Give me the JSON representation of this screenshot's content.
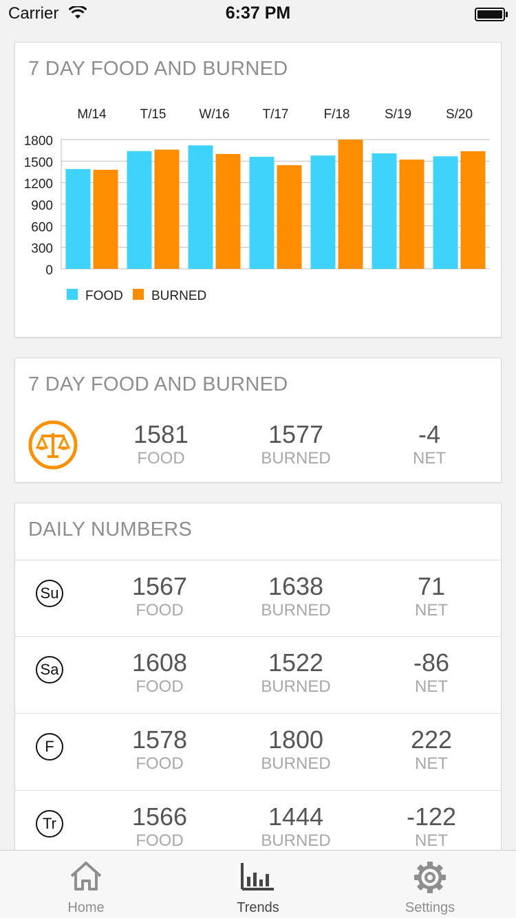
{
  "status_bar": {
    "carrier": "Carrier",
    "time": "6:37 PM",
    "wifi_icon": "wifi-icon",
    "battery_icon": "battery-icon"
  },
  "colors": {
    "food": "#3fd3fb",
    "burned": "#fd8e02",
    "accent": "#fd9100"
  },
  "chart_card": {
    "title": "7 DAY FOOD AND BURNED",
    "chart_data": {
      "type": "bar",
      "categories": [
        "M/14",
        "T/15",
        "W/16",
        "T/17",
        "F/18",
        "S/19",
        "S/20"
      ],
      "series": [
        {
          "name": "FOOD",
          "values": [
            1390,
            1640,
            1720,
            1560,
            1578,
            1608,
            1567
          ]
        },
        {
          "name": "BURNED",
          "values": [
            1380,
            1660,
            1600,
            1444,
            1800,
            1522,
            1638
          ]
        }
      ],
      "y_ticks": [
        0,
        300,
        600,
        900,
        1200,
        1500,
        1800
      ],
      "ylim": [
        0,
        1800
      ],
      "grid": true,
      "legend": "bottom-left"
    }
  },
  "summary_card": {
    "title": "7 DAY FOOD AND BURNED",
    "icon": "scale-icon",
    "food": {
      "value": "1581",
      "label": "FOOD"
    },
    "burned": {
      "value": "1577",
      "label": "BURNED"
    },
    "net": {
      "value": "-4",
      "label": "NET"
    }
  },
  "daily_card": {
    "title": "DAILY NUMBERS",
    "rows": [
      {
        "day": "Su",
        "food": "1567",
        "burned": "1638",
        "net": "71",
        "food_label": "FOOD",
        "burned_label": "BURNED",
        "net_label": "NET"
      },
      {
        "day": "Sa",
        "food": "1608",
        "burned": "1522",
        "net": "-86",
        "food_label": "FOOD",
        "burned_label": "BURNED",
        "net_label": "NET"
      },
      {
        "day": "F",
        "food": "1578",
        "burned": "1800",
        "net": "222",
        "food_label": "FOOD",
        "burned_label": "BURNED",
        "net_label": "NET"
      },
      {
        "day": "Tr",
        "food": "1566",
        "burned": "1444",
        "net": "-122",
        "food_label": "FOOD",
        "burned_label": "BURNED",
        "net_label": "NET"
      }
    ]
  },
  "tab_bar": {
    "tabs": [
      {
        "label": "Home",
        "icon": "home-icon",
        "active": false
      },
      {
        "label": "Trends",
        "icon": "bar-chart-icon",
        "active": true
      },
      {
        "label": "Settings",
        "icon": "gear-icon",
        "active": false
      }
    ]
  }
}
